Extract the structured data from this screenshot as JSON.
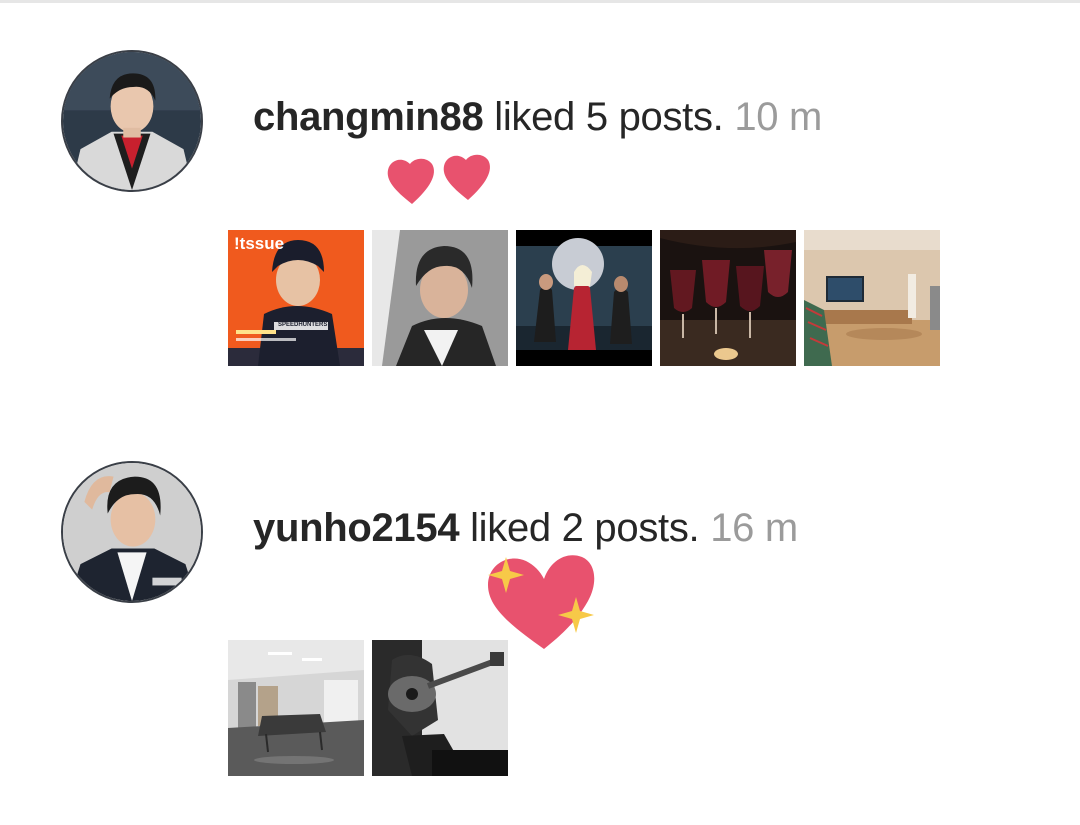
{
  "notifications": [
    {
      "username": "changmin88",
      "action": "liked 5 posts.",
      "time": "10 m",
      "avatar_icon": "avatar-photo-changmin88",
      "decoration_icon": "two-hearts-icon",
      "posts": [
        {
          "name": "magazine-cover-thumbnail",
          "title_text": "!tssue",
          "badge_text": "SPEEDHUNTERS"
        },
        {
          "name": "selfie-thumbnail"
        },
        {
          "name": "music-video-still-thumbnail"
        },
        {
          "name": "wine-glasses-thumbnail"
        },
        {
          "name": "living-room-tv-thumbnail"
        }
      ]
    },
    {
      "username": "yunho2154",
      "action": "liked 2 posts.",
      "time": "16 m",
      "avatar_icon": "avatar-photo-yunho2154",
      "decoration_icon": "sparkling-heart-icon",
      "posts": [
        {
          "name": "office-room-thumbnail"
        },
        {
          "name": "guitar-player-thumbnail"
        }
      ]
    }
  ],
  "colors": {
    "username": "#262626",
    "time": "#9b9b9b",
    "heart": "#e8526e",
    "sparkle": "#f7c948"
  }
}
